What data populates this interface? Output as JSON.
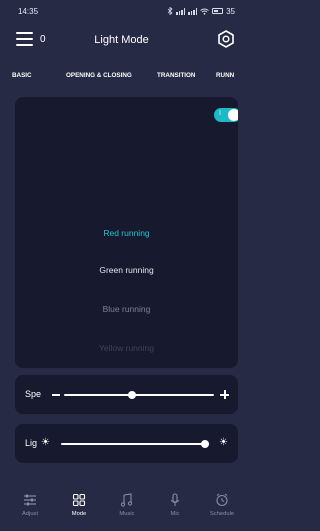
{
  "status_bar": {
    "time": "14:35",
    "battery": "35"
  },
  "header": {
    "title": "Light Mode",
    "menu_count": "0"
  },
  "tabs": [
    {
      "label": "BASIC"
    },
    {
      "label": "OPENING & CLOSING"
    },
    {
      "label": "TRANSITION"
    },
    {
      "label": "RUNN"
    }
  ],
  "mode_toggle": {
    "on": true
  },
  "modes": [
    {
      "label": "Red running",
      "selected": true
    },
    {
      "label": "Green running"
    },
    {
      "label": "Blue running"
    },
    {
      "label": "Yellow running"
    }
  ],
  "speed": {
    "label": "Spe",
    "level": 0.45
  },
  "brightness": {
    "label": "Lig",
    "level": 0.97
  },
  "bottom_nav": [
    {
      "label": "Adjust",
      "icon": "sliders-icon"
    },
    {
      "label": "Mode",
      "icon": "grid-icon",
      "active": true
    },
    {
      "label": "Music",
      "icon": "music-icon"
    },
    {
      "label": "Mic",
      "icon": "mic-icon"
    },
    {
      "label": "Schedule",
      "icon": "clock-icon"
    }
  ],
  "colors": {
    "accent": "#25c2cf",
    "background": "#262a45",
    "panel": "#171a2e"
  }
}
